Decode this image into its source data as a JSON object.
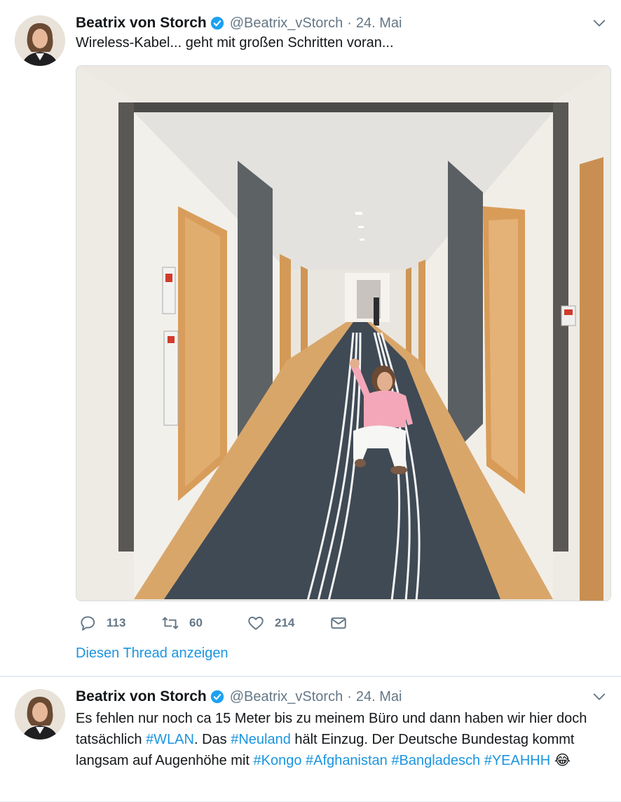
{
  "tweets": [
    {
      "author": {
        "name": "Beatrix von Storch",
        "handle": "@Beatrix_vStorch",
        "date": "24. Mai"
      },
      "text": "Wireless-Kabel... geht mit großen Schritten voran...",
      "stats": {
        "replies": "113",
        "retweets": "60",
        "likes": "214"
      },
      "thread_link": "Diesen Thread anzeigen"
    },
    {
      "author": {
        "name": "Beatrix von Storch",
        "handle": "@Beatrix_vStorch",
        "date": "24. Mai"
      },
      "text_parts": {
        "p1": "Es fehlen nur noch ca 15 Meter bis zu meinem Büro und dann haben wir hier doch tatsächlich ",
        "h1": "#WLAN",
        "p2": ". Das ",
        "h2": "#Neuland",
        "p3": " hält Einzug. Der Deutsche Bundestag kommt langsam auf Augenhöhe mit  ",
        "h3": "#Kongo",
        "p4": " ",
        "h4": "#Afghanistan",
        "p5": " ",
        "h5": "#Bangladesch",
        "p6": " ",
        "h6": "#YEAHHH",
        "emoji": "😂"
      }
    }
  ],
  "colors": {
    "link": "#1b95e0",
    "muted": "#657786",
    "text": "#14171a",
    "verified": "#1da1f2"
  }
}
